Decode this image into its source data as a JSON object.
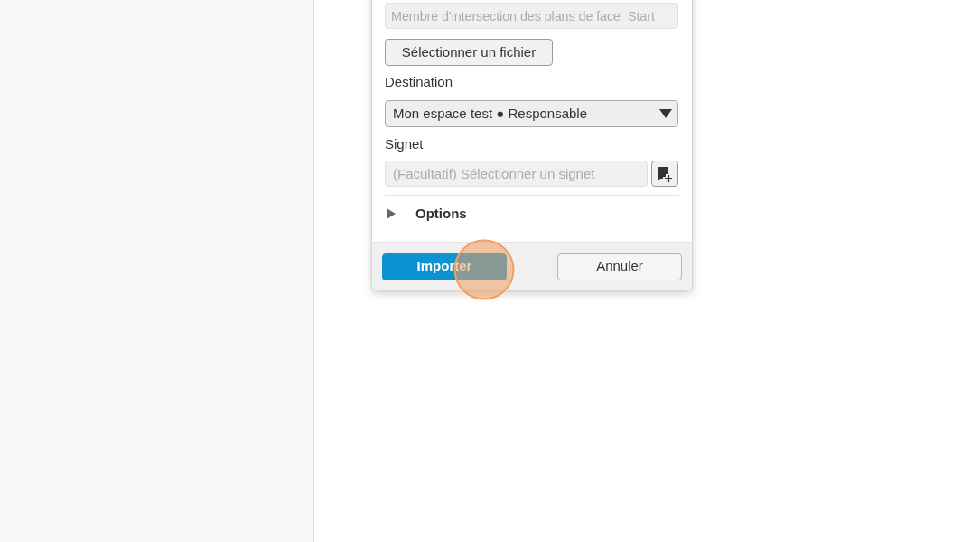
{
  "dialog": {
    "file_field": {
      "value": "Membre d'intersection des plans de face_Start",
      "disabled": true
    },
    "select_file_button": "Sélectionner un fichier",
    "destination": {
      "label": "Destination",
      "value": "Mon espace test ● Responsable"
    },
    "bookmark": {
      "label": "Signet",
      "placeholder": "(Facultatif) Sélectionner un signet"
    },
    "options": {
      "label": "Options",
      "expanded": false
    },
    "buttons": [
      {
        "label": "Importer",
        "kind": "primary"
      },
      {
        "label": "Annuler",
        "kind": "secondary"
      }
    ]
  }
}
